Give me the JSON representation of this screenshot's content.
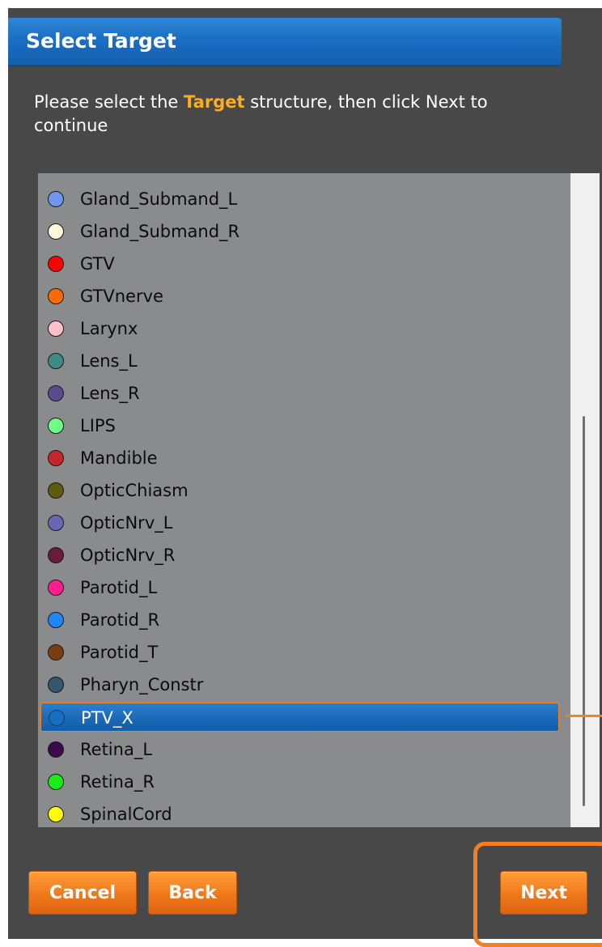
{
  "dialog": {
    "title": "Select Target",
    "instruction_before": "Please select the ",
    "instruction_highlight": "Target",
    "instruction_after": " structure, then click Next to continue"
  },
  "structures": [
    {
      "label": "Gland_Submand_L",
      "color": "#6f97ef"
    },
    {
      "label": "Gland_Submand_R",
      "color": "#fff7dc"
    },
    {
      "label": "GTV",
      "color": "#ff0000"
    },
    {
      "label": "GTVnerve",
      "color": "#ff6a00"
    },
    {
      "label": "Larynx",
      "color": "#ffc0cb"
    },
    {
      "label": "Lens_L",
      "color": "#3e8a86"
    },
    {
      "label": "Lens_R",
      "color": "#5a4a90"
    },
    {
      "label": "LIPS",
      "color": "#6dff86"
    },
    {
      "label": "Mandible",
      "color": "#c8252a"
    },
    {
      "label": "OpticChiasm",
      "color": "#5e5a0e"
    },
    {
      "label": "OpticNrv_L",
      "color": "#6a66b4"
    },
    {
      "label": "OpticNrv_R",
      "color": "#6a1a3c"
    },
    {
      "label": "Parotid_L",
      "color": "#ff1e8c"
    },
    {
      "label": "Parotid_R",
      "color": "#1e86ff"
    },
    {
      "label": "Parotid_T",
      "color": "#7a3e0e"
    },
    {
      "label": "Pharyn_Constr",
      "color": "#34566e"
    },
    {
      "label": "PTV_X",
      "color": "#1a6ec2",
      "selected": true
    },
    {
      "label": "Retina_L",
      "color": "#3a0a4a"
    },
    {
      "label": "Retina_R",
      "color": "#16ee16"
    },
    {
      "label": "SpinalCord",
      "color": "#ffff00"
    }
  ],
  "buttons": {
    "cancel": "Cancel",
    "back": "Back",
    "next": "Next"
  },
  "colors": {
    "accent_orange": "#f0851f",
    "header_blue": "#1a6fc4",
    "panel_bg": "#484848",
    "list_bg": "#8a8b8d"
  }
}
